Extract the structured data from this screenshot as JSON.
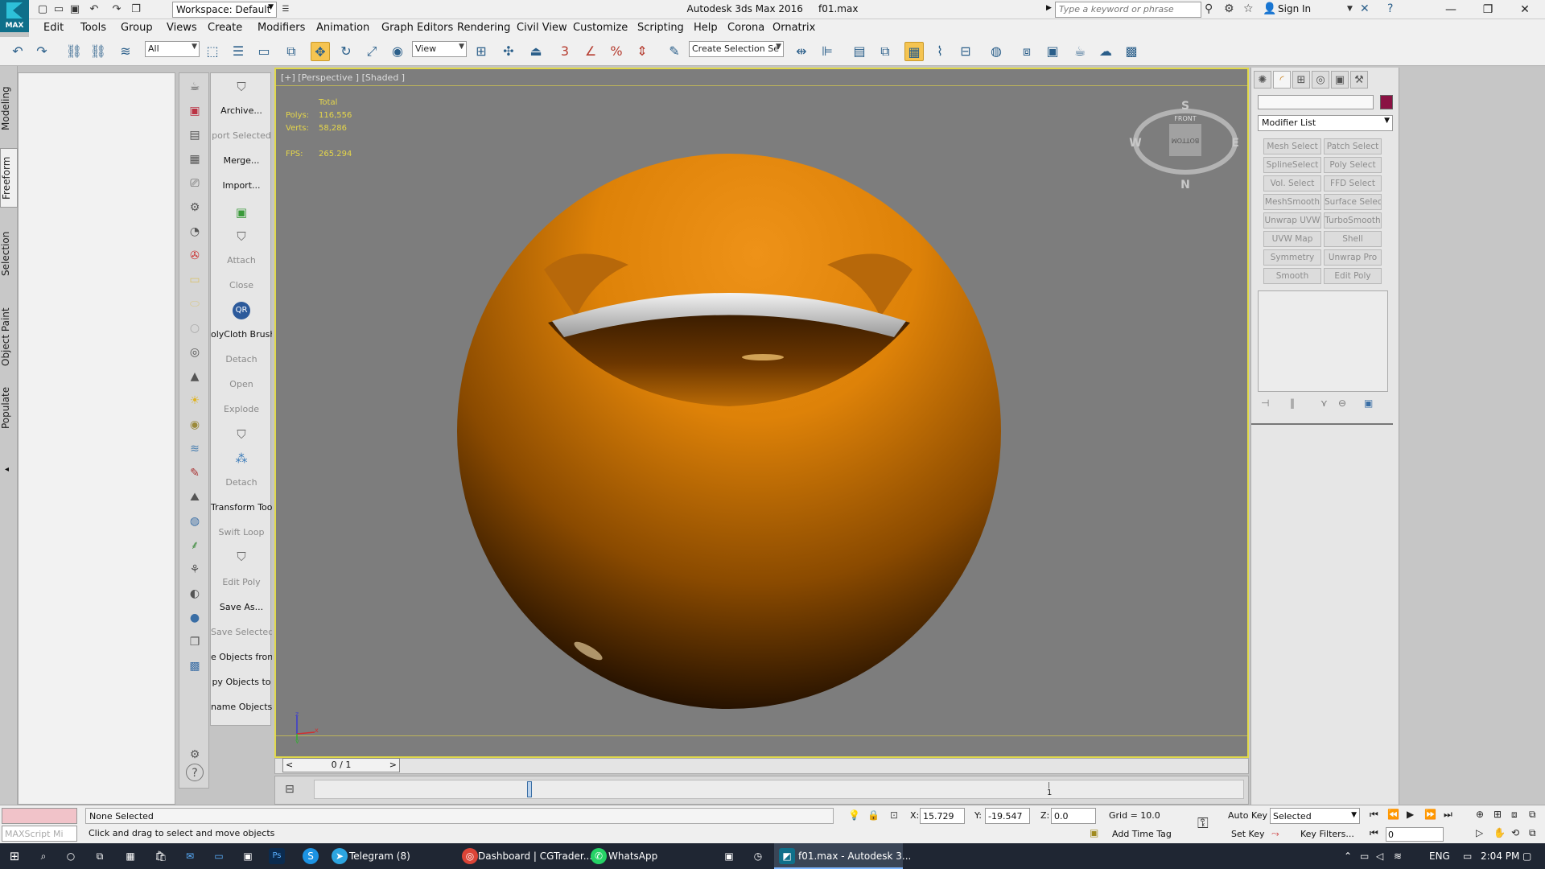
{
  "app": {
    "title": "Autodesk 3ds Max 2016",
    "file": "f01.max",
    "logo_text": "MAX",
    "workspace": "Workspace: Default",
    "search_placeholder": "Type a keyword or phrase",
    "sign_in": "Sign In"
  },
  "menu": [
    "Edit",
    "Tools",
    "Group",
    "Views",
    "Create",
    "Modifiers",
    "Animation",
    "Graph Editors",
    "Rendering",
    "Civil View",
    "Customize",
    "Scripting",
    "Help",
    "Corona",
    "Ornatrix"
  ],
  "toolbar": {
    "selection_filter": "All",
    "ref_coord": "View",
    "named_selection_placeholder": "Create Selection Se",
    "snap_3": "3",
    "percent_snap": "%"
  },
  "ribbon_tabs": [
    "Modeling",
    "Freeform",
    "Selection",
    "Object Paint",
    "Populate"
  ],
  "ribbon_selected": "Freeform",
  "script_buttons": [
    {
      "label": "Archive...",
      "enabled": true
    },
    {
      "label": "port Selected",
      "enabled": false
    },
    {
      "label": "Merge...",
      "enabled": true
    },
    {
      "label": "Import...",
      "enabled": true
    },
    {
      "label": "Attach",
      "enabled": false
    },
    {
      "label": "Close",
      "enabled": false
    },
    {
      "label": "olyCloth Brush",
      "enabled": true
    },
    {
      "label": "Detach",
      "enabled": false
    },
    {
      "label": "Open",
      "enabled": false
    },
    {
      "label": "Explode",
      "enabled": false
    },
    {
      "label": "Detach",
      "enabled": false
    },
    {
      "label": "Transform Tool",
      "enabled": true
    },
    {
      "label": "Swift Loop",
      "enabled": false
    },
    {
      "label": "Edit Poly",
      "enabled": false
    },
    {
      "label": "Save As...",
      "enabled": true
    },
    {
      "label": "Save Selected",
      "enabled": false
    },
    {
      "label": "e Objects fron",
      "enabled": true
    },
    {
      "label": "py Objects to",
      "enabled": true
    },
    {
      "label": "name Objects",
      "enabled": true
    }
  ],
  "viewport": {
    "label": "[+] [Perspective ] [Shaded ]",
    "stats": {
      "header": "Total",
      "polys_label": "Polys:",
      "polys": "116,556",
      "verts_label": "Verts:",
      "verts": "58,286",
      "fps_label": "FPS:",
      "fps": "265.294"
    },
    "viewcube": {
      "top": "S",
      "bottom": "N",
      "left": "W",
      "right": "E",
      "face_top": "FRONT",
      "face": "BOTTOM"
    },
    "axis": {
      "x": "x",
      "z": "z",
      "y": "y"
    }
  },
  "timeline": {
    "slider": "0 / 1",
    "prev": "<",
    "next": ">",
    "tick": "1"
  },
  "command_panel": {
    "modifier_list": "Modifier List",
    "color": "#8a1243",
    "modifier_buttons": [
      "Mesh Select",
      "Patch Select",
      "SplineSelect",
      "Poly Select",
      "Vol. Select",
      "FFD Select",
      "MeshSmooth",
      "Surface Select",
      "Unwrap UVW",
      "TurboSmooth",
      "UVW Map",
      "Shell",
      "Symmetry",
      "Unwrap Pro",
      "Smooth",
      "Edit Poly"
    ]
  },
  "status": {
    "maxscript_placeholder": "MAXScript Mi",
    "selection": "None Selected",
    "prompt": "Click and drag to select and move objects",
    "x_label": "X:",
    "x": "15.729",
    "y_label": "Y:",
    "y": "-19.547",
    "z_label": "Z:",
    "z": "0.0",
    "grid": "Grid = 10.0",
    "add_time_tag": "Add Time Tag",
    "auto_key": "Auto Key",
    "set_key": "Set Key",
    "key_mode": "Selected",
    "key_filters": "Key Filters...",
    "frame": "0"
  },
  "taskbar": {
    "items": [
      "Telegram (8)",
      "Dashboard | CGTrader...",
      "WhatsApp",
      "f01.max - Autodesk 3..."
    ],
    "lang": "ENG",
    "time": "2:04 PM"
  },
  "colors": {
    "object": "#e08a0a",
    "viewport_bg": "#7d7d7d",
    "viewport_border": "#e1d94a",
    "stats": "#e5d64a",
    "active_tool": "#f5c451"
  }
}
